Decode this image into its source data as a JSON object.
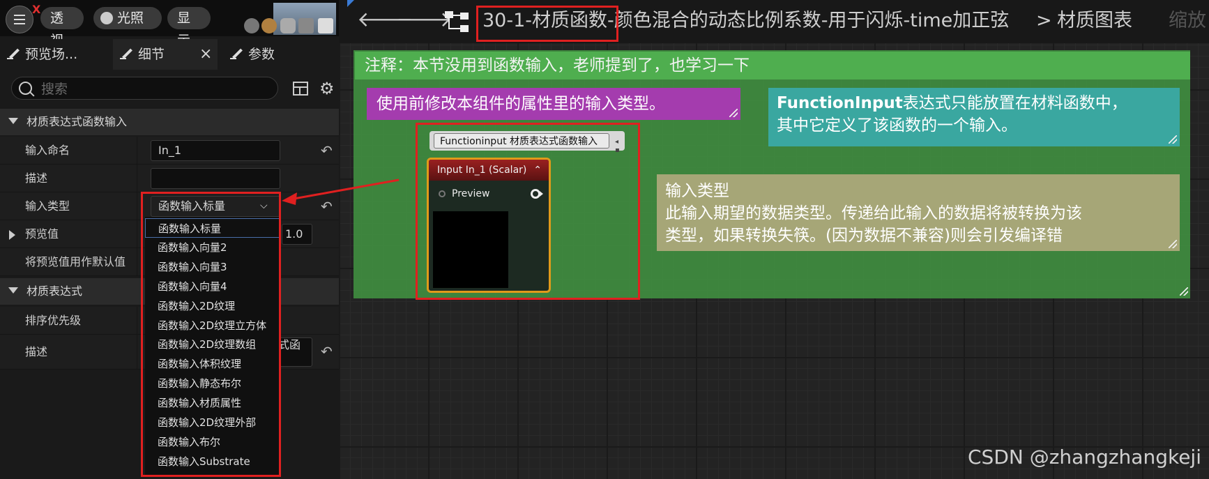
{
  "viewport": {
    "toggle_label": "透视",
    "lit_label": "光照",
    "show_label": "显示"
  },
  "tabs": [
    {
      "label": "预览场..."
    },
    {
      "label": "细节",
      "close": "×"
    },
    {
      "label": "参数"
    }
  ],
  "search": {
    "placeholder": "搜索"
  },
  "details": {
    "section1_title": "材质表达式函数输入",
    "input_name_label": "输入命名",
    "input_name_value": "In_1",
    "description_label": "描述",
    "description_value": "",
    "input_type_label": "输入类型",
    "input_type_value": "函数输入标量",
    "preview_value_label": "预览值",
    "preview_value": "1.0",
    "use_preview_default_label": "将预览值用作默认值",
    "section2_title": "材质表达式",
    "sort_priority_label": "排序优先级",
    "description2_label": "描述",
    "description2_value_fragment": "式函"
  },
  "dropdown_options": [
    "函数输入标量",
    "函数输入向量2",
    "函数输入向量3",
    "函数输入向量4",
    "函数输入2D纹理",
    "函数输入2D纹理立方体",
    "函数输入2D纹理数组",
    "函数输入体积纹理",
    "函数输入静态布尔",
    "函数输入材质属性",
    "函数输入2D纹理外部",
    "函数输入布尔",
    "函数输入Substrate"
  ],
  "graph": {
    "title": "30-1-材质函数-颜色混合的动态比例系数-用于闪烁-time加正弦",
    "breadcrumb_separator": ">",
    "breadcrumb_graph": "材质图表",
    "zoom_label": "缩放",
    "comment_main": "注释：本节没用到函数输入，老师提到了，也学习一下",
    "note_purple": "使用前修改本组件的属性里的输入类型。",
    "note_teal_bold": "FunctionInput",
    "note_teal_rest": "表达式只能放置在材料函数中，",
    "note_teal_line2": "其中它定义了该函数的一个输入。",
    "note_khaki_line1": "输入类型",
    "note_khaki_line2": "此输入期望的数据类型。传递给此输入的数据将被转换为该",
    "note_khaki_line3": "类型，如果转换失筷。(因为数据不兼容)则会引发编译错",
    "node_tag": "Functioninput  材质表达式函数输入",
    "node_header": "Input In_1 (Scalar)",
    "node_pin_label": "Preview"
  },
  "watermark": "CSDN @zhangzhangkeji",
  "colors": {
    "highlight_red": "#e02020",
    "comment_green": "#4fae4f",
    "note_purple": "#a43cae",
    "note_teal": "#3aa7a0",
    "note_khaki": "#a6a677",
    "node_border": "#e09a1a"
  }
}
